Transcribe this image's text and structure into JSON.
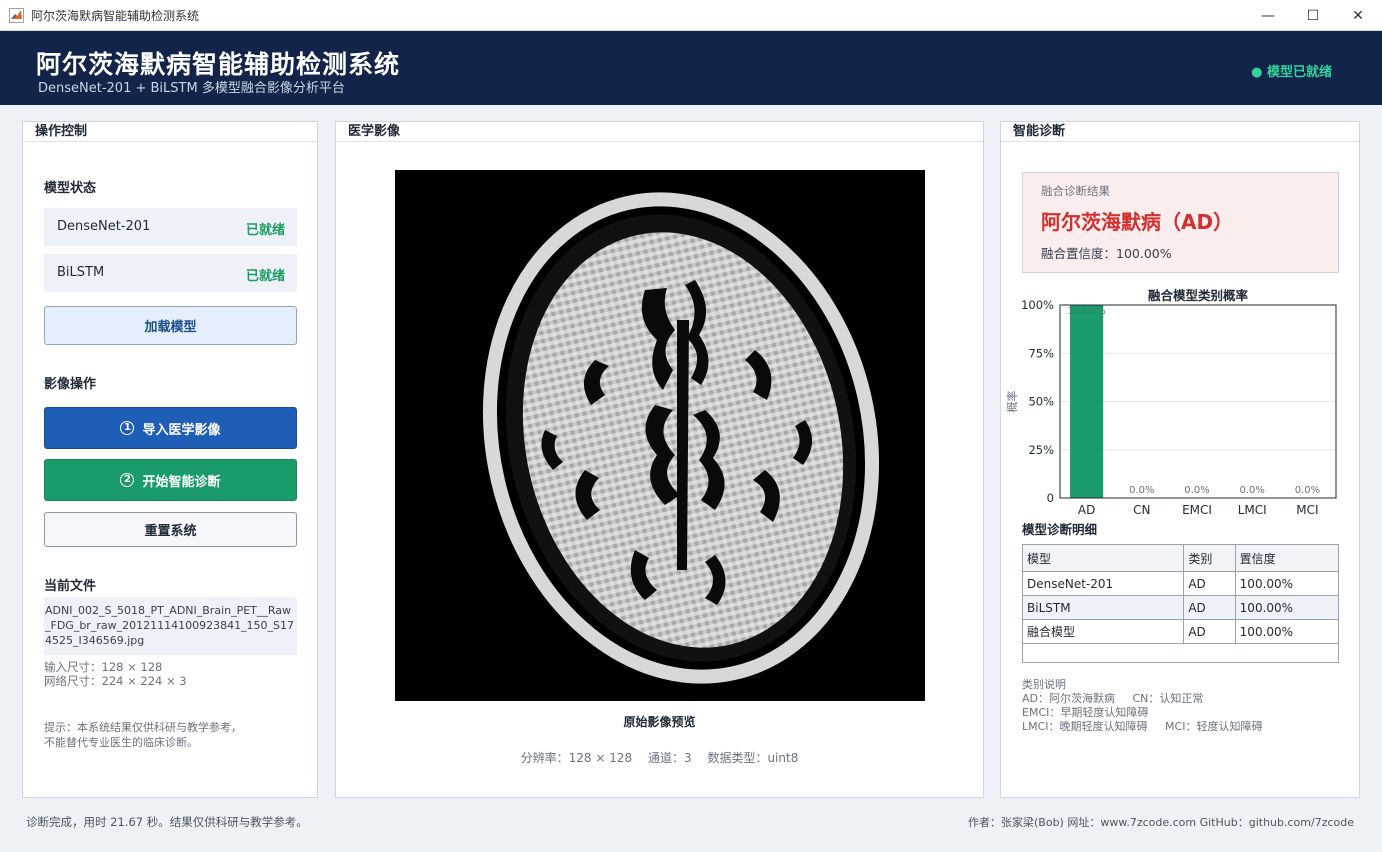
{
  "window": {
    "title": "阿尔茨海默病智能辅助检测系统",
    "minimize_glyph": "—",
    "maximize_glyph": "☐",
    "close_glyph": "✕"
  },
  "header": {
    "title": "阿尔茨海默病智能辅助检测系统",
    "subtitle": "DenseNet-201 + BiLSTM 多模型融合影像分析平台",
    "status": "● 模型已就绪",
    "status_color": "#34d399"
  },
  "left_panel": {
    "title": "操作控制",
    "model_status_label": "模型状态",
    "models": [
      {
        "name": "DenseNet-201",
        "status": "已就绪"
      },
      {
        "name": "BiLSTM",
        "status": "已就绪"
      }
    ],
    "load_button": "加载模型",
    "image_ops_label": "影像操作",
    "import_button_num": "1",
    "import_button": "导入医学影像",
    "diagnose_button_num": "2",
    "diagnose_button": "开始智能诊断",
    "reset_button": "重置系统",
    "current_file_label": "当前文件",
    "current_file": "ADNI_002_S_5018_PT_ADNI_Brain_PET__Raw_FDG_br_raw_20121114100923841_150_S174525_I346569.jpg",
    "input_size": "输入尺寸：128 × 128",
    "network_size": "网络尺寸：224 × 224 × 3",
    "tip_line1": "提示：本系统结果仅供科研与教学参考，",
    "tip_line2": "不能替代专业医生的临床诊断。"
  },
  "middle_panel": {
    "title": "医学影像",
    "caption": "原始影像预览",
    "resolution": "分辨率：128 × 128",
    "channels": "通道：3",
    "dtype": "数据类型：uint8"
  },
  "right_panel": {
    "title": "智能诊断",
    "result_label": "融合诊断结果",
    "result_value": "阿尔茨海默病（AD）",
    "result_confidence": "融合置信度：100.00%",
    "detail_label": "模型诊断明细",
    "table_headers": [
      "模型",
      "类别",
      "置信度"
    ],
    "table_rows": [
      [
        "DenseNet-201",
        "AD",
        "100.00%"
      ],
      [
        "BiLSTM",
        "AD",
        "100.00%"
      ],
      [
        "融合模型",
        "AD",
        "100.00%"
      ]
    ],
    "legend_title": "类别说明",
    "legend_line1": "AD：阿尔茨海默病     CN：认知正常",
    "legend_line2": "EMCI：早期轻度认知障碍",
    "legend_line3": "LMCI：晚期轻度认知障碍     MCI：轻度认知障碍"
  },
  "chart_data": {
    "type": "bar",
    "title": "融合模型类别概率",
    "ylabel": "概率",
    "xlabel": "",
    "categories": [
      "AD",
      "CN",
      "EMCI",
      "LMCI",
      "MCI"
    ],
    "values": [
      100,
      0,
      0,
      0,
      0
    ],
    "value_labels": [
      "100.0%",
      "0.0%",
      "0.0%",
      "0.0%",
      "0.0%"
    ],
    "ylim": [
      0,
      100
    ],
    "ytick_labels": [
      "0",
      "25%",
      "50%",
      "75%",
      "100%"
    ],
    "grid": true,
    "bar_color": "#1a9b6a"
  },
  "status_bar": {
    "left": "诊断完成，用时 21.67 秒。结果仅供科研与教学参考。",
    "right": "作者：张家梁(Bob)  网址：www.7zcode.com  GitHub：github.com/7zcode"
  }
}
